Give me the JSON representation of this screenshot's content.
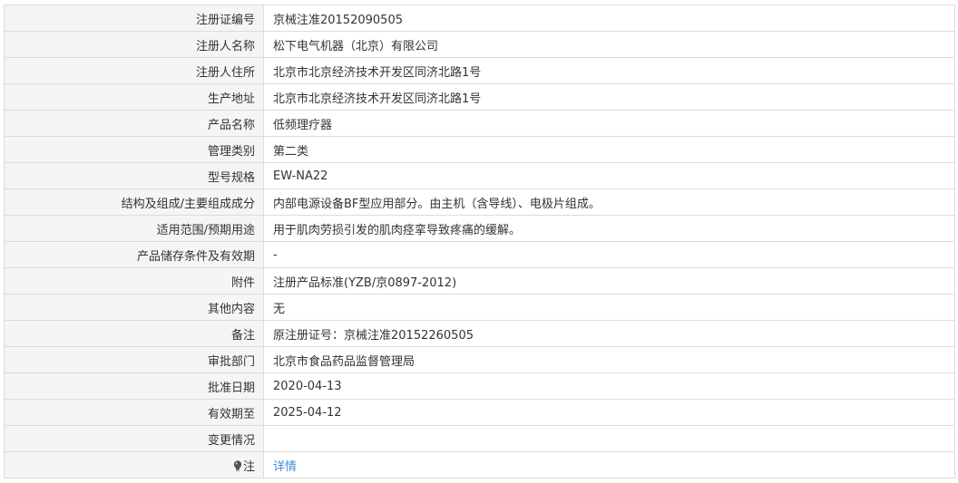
{
  "rows": [
    {
      "label": "注册证编号",
      "value": "京械注准20152090505"
    },
    {
      "label": "注册人名称",
      "value": "松下电气机器（北京）有限公司"
    },
    {
      "label": "注册人住所",
      "value": "北京市北京经济技术开发区同济北路1号"
    },
    {
      "label": "生产地址",
      "value": "北京市北京经济技术开发区同济北路1号"
    },
    {
      "label": "产品名称",
      "value": "低频理疗器"
    },
    {
      "label": "管理类别",
      "value": "第二类"
    },
    {
      "label": "型号规格",
      "value": "EW-NA22"
    },
    {
      "label": "结构及组成/主要组成成分",
      "value": "内部电源设备BF型应用部分。由主机（含导线）、电极片组成。"
    },
    {
      "label": "适用范围/预期用途",
      "value": "用于肌肉劳损引发的肌肉痉挛导致疼痛的缓解。"
    },
    {
      "label": "产品储存条件及有效期",
      "value": "-"
    },
    {
      "label": "附件",
      "value": "注册产品标准(YZB/京0897-2012)"
    },
    {
      "label": "其他内容",
      "value": "无"
    },
    {
      "label": "备注",
      "value": "原注册证号：京械注准20152260505"
    },
    {
      "label": "审批部门",
      "value": "北京市食品药品监督管理局"
    },
    {
      "label": "批准日期",
      "value": "2020-04-13"
    },
    {
      "label": "有效期至",
      "value": "2025-04-12"
    },
    {
      "label": "变更情况",
      "value": ""
    }
  ],
  "note_row": {
    "icon": "lightbulb-icon",
    "label": "注",
    "link_text": "详情"
  },
  "colors": {
    "label_background": "#f5f5f5",
    "border": "#dcdcdc",
    "text": "#333333",
    "link": "#3d8fd6"
  }
}
